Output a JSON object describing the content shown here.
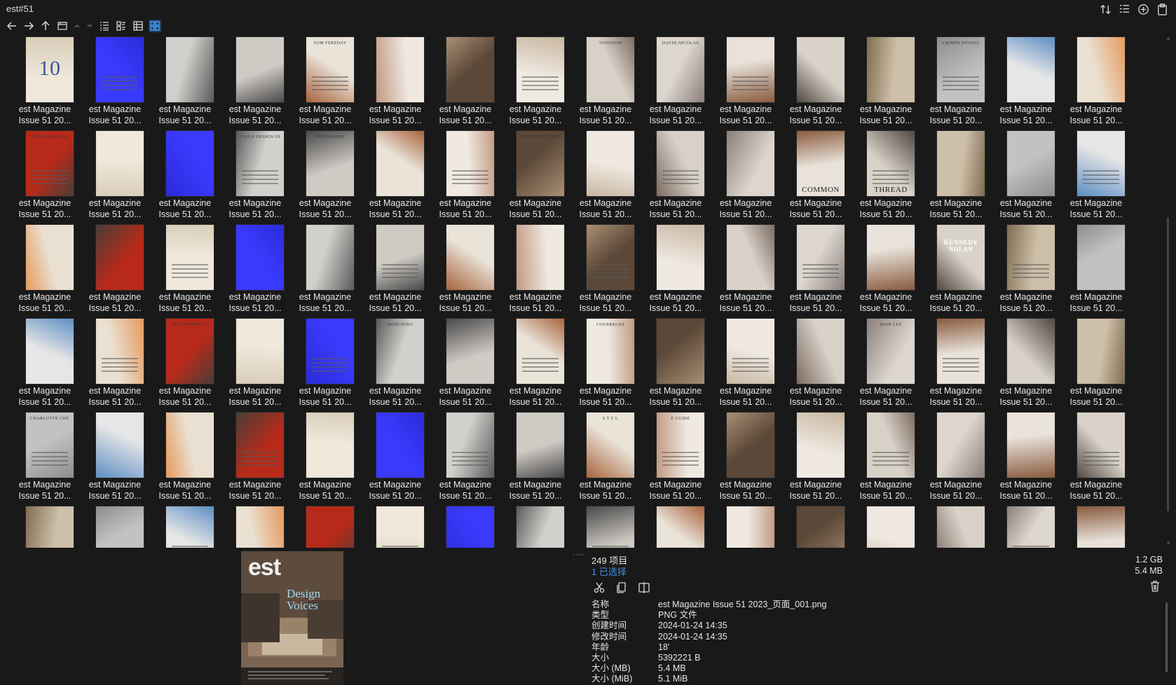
{
  "window": {
    "title": "est#51"
  },
  "top_icons": [
    "sort-icon",
    "list-view-icon",
    "add-circle-icon",
    "paste-icon"
  ],
  "toolbar": {
    "buttons": [
      {
        "name": "back-button",
        "icon": "arrow-left-icon"
      },
      {
        "name": "forward-button",
        "icon": "arrow-right-icon"
      },
      {
        "name": "up-button",
        "icon": "arrow-up-icon"
      },
      {
        "name": "history-button",
        "icon": "folder-history-icon"
      },
      {
        "name": "scroll-up-button",
        "icon": "chevron-up-icon"
      },
      {
        "name": "scroll-down-button",
        "icon": "chevron-down-icon"
      },
      {
        "name": "details-view-button",
        "icon": "details-view-icon"
      },
      {
        "name": "tiles-view-button",
        "icon": "tiles-view-icon"
      },
      {
        "name": "content-view-button",
        "icon": "content-view-icon"
      },
      {
        "name": "thumbnail-view-button",
        "icon": "thumbnail-grid-icon",
        "active": true
      }
    ]
  },
  "grid": {
    "label_line1": "est Magazine",
    "label_line2": "Issue 51 20...",
    "thumb_heads": {
      "1": "10",
      "5": "TOM FEREDAY",
      "9": "TOOGOOD",
      "10": "DAVID NICOLAS",
      "14": "CRIMES STUDIO",
      "17": "INDIA MAHDAVI",
      "20": "CAIUS DESIGN OFFICE",
      "21": "STUDIOPEPE",
      "24": "MULLER VAN SEVEREN",
      "28": "COMMON",
      "29": "THREAD",
      "46": "KENNEDY NOLAN",
      "51": "THE ARCHITECTURE OF FASHION",
      "54": "MOSCHINO",
      "57": "COURREGES",
      "61": "DION LEE",
      "65": "CHARLOTTE CHESNAIS",
      "73": "S T Y L",
      "74": "E GUIDE"
    }
  },
  "preview": {
    "brand": "est",
    "headline": "Design Voices"
  },
  "info": {
    "item_count": "249 项目",
    "selected_count": "1 已选择",
    "actions": [
      "cut-icon",
      "copy-icon",
      "compare-icon"
    ],
    "properties": [
      {
        "key": "名称",
        "value": "est Magazine Issue 51 2023_页面_001.png"
      },
      {
        "key": "类型",
        "value": "PNG 文件"
      },
      {
        "key": "创建时间",
        "value": "2024-01-24   14:35"
      },
      {
        "key": "修改时间",
        "value": "2024-01-24   14:35"
      },
      {
        "key": "年龄",
        "value": "18'"
      },
      {
        "key": "大小",
        "value": "5392221 B"
      },
      {
        "key": "大小 (MB)",
        "value": "5.4 MB"
      },
      {
        "key": "大小 (MiB)",
        "value": "5.1 MiB"
      }
    ],
    "size_total": "1.2 GB",
    "size_selected": "5.4 MB"
  }
}
